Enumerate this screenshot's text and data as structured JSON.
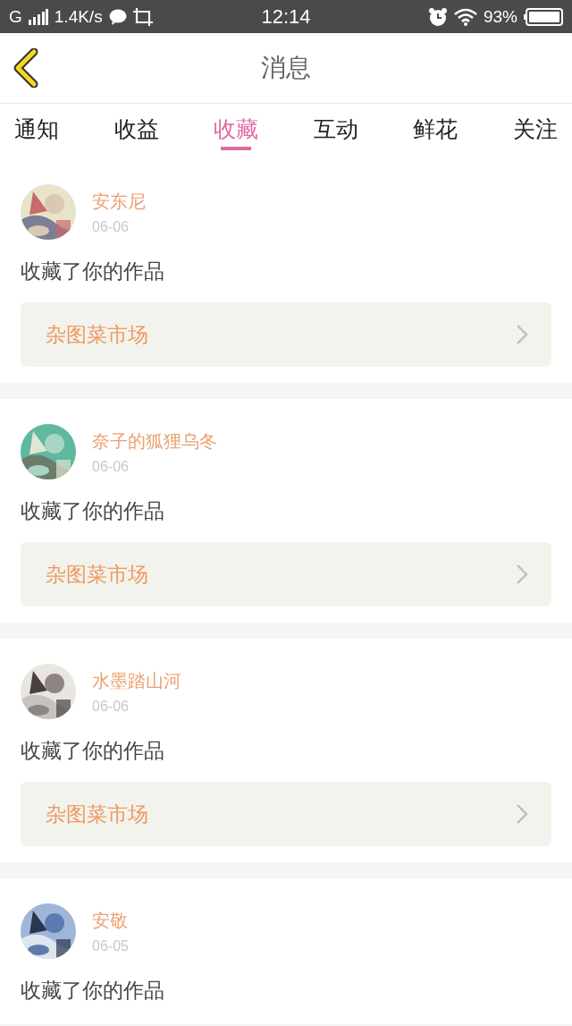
{
  "status_bar": {
    "network": "G",
    "speed": "1.4K/s",
    "time": "12:14",
    "battery": "93%"
  },
  "header": {
    "title": "消息"
  },
  "tabs": [
    {
      "label": "通知",
      "selected": false
    },
    {
      "label": "收益",
      "selected": false
    },
    {
      "label": "收藏",
      "selected": true
    },
    {
      "label": "互动",
      "selected": false
    },
    {
      "label": "鲜花",
      "selected": false
    },
    {
      "label": "关注",
      "selected": false
    }
  ],
  "messages": [
    {
      "name": "安东尼",
      "date": "06-06",
      "text": "收藏了你的作品",
      "link": "杂图菜市场"
    },
    {
      "name": "奈子的狐狸乌冬",
      "date": "06-06",
      "text": "收藏了你的作品",
      "link": "杂图菜市场"
    },
    {
      "name": "水墨踏山河",
      "date": "06-06",
      "text": "收藏了你的作品",
      "link": "杂图菜市场"
    },
    {
      "name": "安敬",
      "date": "06-05",
      "text": "收藏了你的作品"
    }
  ]
}
